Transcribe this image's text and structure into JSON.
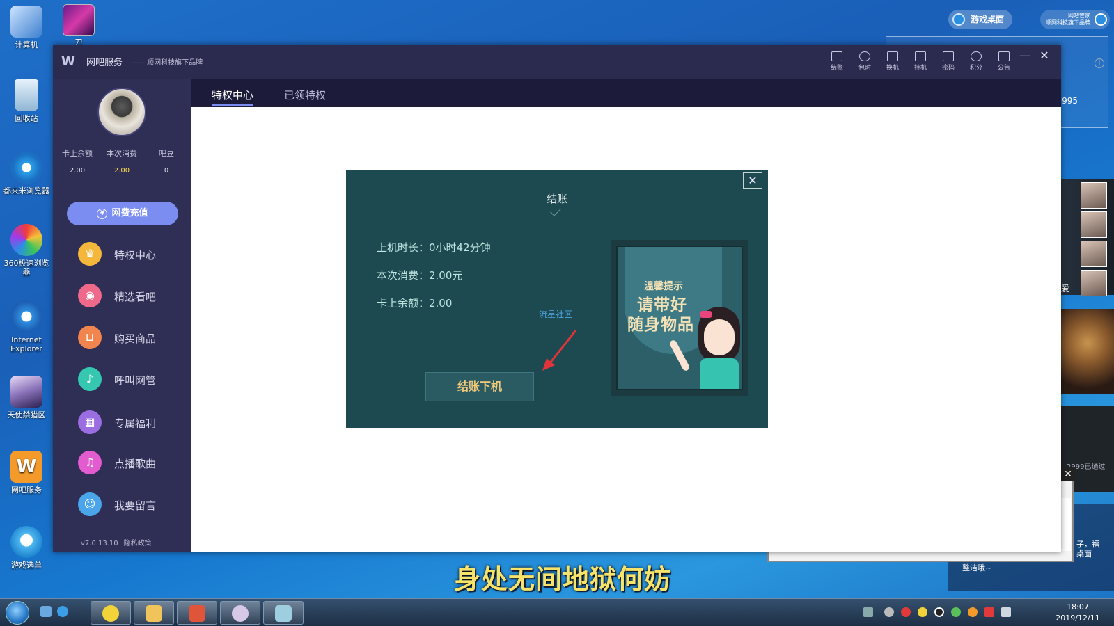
{
  "desktop": {
    "icons": [
      {
        "label": "计算机",
        "icon": "computer-icon",
        "color": "#4a8ed8"
      },
      {
        "label": "回收站",
        "icon": "recycle-bin-icon",
        "color": "#9ec4e0"
      },
      {
        "label": "都来米浏览器",
        "icon": "browser-e-icon",
        "color": "#2a9ee8"
      },
      {
        "label": "360极速浏览器",
        "icon": "browser-360-icon",
        "color": "#f2c33a"
      },
      {
        "label": "Internet Explorer",
        "icon": "ie-icon",
        "color": "#2f8ee0"
      },
      {
        "label": "天使禁猎区",
        "icon": "game-angel-icon",
        "color": "#b8a6d8"
      },
      {
        "label": "网吧服务",
        "icon": "netbar-service-icon",
        "color": "#f39a2a"
      },
      {
        "label": "游戏选单",
        "icon": "game-menu-icon",
        "color": "#4fb8f0"
      }
    ],
    "top_game_label": "刀9999/3",
    "game_desktop_label": "游戏桌面",
    "brand_label_line1": "网吧管家",
    "brand_label_line2": "顺网科技旗下品牌",
    "right_panel_number": "3995",
    "passed_text": "2999已通过",
    "side_text_line1": "子，福",
    "side_text_line2": "桌面",
    "clean_text": "整洁哦~",
    "ai_label": "爱",
    "lyric": "身处无间地狱何妨"
  },
  "window": {
    "app_name": "网吧服务",
    "slogan": "—— 顺网科技旗下品牌",
    "tools": [
      {
        "label": "结账",
        "icon": "checkout-icon"
      },
      {
        "label": "包时",
        "icon": "clock-icon"
      },
      {
        "label": "换机",
        "icon": "switch-machine-icon"
      },
      {
        "label": "挂机",
        "icon": "idle-icon"
      },
      {
        "label": "密码",
        "icon": "lock-icon"
      },
      {
        "label": "积分",
        "icon": "points-icon"
      },
      {
        "label": "公告",
        "icon": "announcement-icon"
      }
    ],
    "minimize": "—",
    "close": "✕"
  },
  "sidebar": {
    "stats": [
      {
        "label": "卡上余额",
        "value": "2.00"
      },
      {
        "label": "本次消费",
        "value": "2.00"
      },
      {
        "label": "吧豆",
        "value": "0"
      }
    ],
    "recharge_label": "网费充值",
    "recharge_icon_glyph": "¥",
    "menu": [
      {
        "label": "特权中心",
        "icon": "crown-icon",
        "glyph": "♛",
        "color": "#f5b73b"
      },
      {
        "label": "精选看吧",
        "icon": "eye-icon",
        "glyph": "◉",
        "color": "#ef6a8a"
      },
      {
        "label": "购买商品",
        "icon": "basket-icon",
        "glyph": "⊔",
        "color": "#f2854e"
      },
      {
        "label": "呼叫网管",
        "icon": "microphone-icon",
        "glyph": "♪",
        "color": "#35c7b0"
      },
      {
        "label": "专属福利",
        "icon": "gift-icon",
        "glyph": "▦",
        "color": "#9a6de0"
      },
      {
        "label": "点播歌曲",
        "icon": "music-icon",
        "glyph": "♫",
        "color": "#e25bcf"
      },
      {
        "label": "我要留言",
        "icon": "chat-icon",
        "glyph": "☺",
        "color": "#4aa5ea"
      }
    ],
    "version": "v7.0.13.10",
    "privacy": "隐私政策"
  },
  "tabs": [
    {
      "label": "特权中心",
      "active": true
    },
    {
      "label": "已领特权",
      "active": false
    }
  ],
  "modal": {
    "title": "结账",
    "close": "✕",
    "online_time": "上机时长：0小时42分钟",
    "consumption": "本次消费：2.00元",
    "balance": "卡上余额：2.00",
    "community_link": "流星社区",
    "checkout_button": "结账下机",
    "poster_tip": "温馨提示",
    "poster_line1": "请带好",
    "poster_line2": "随身物品"
  },
  "taskbar": {
    "time": "18:07",
    "date": "2019/12/11"
  }
}
